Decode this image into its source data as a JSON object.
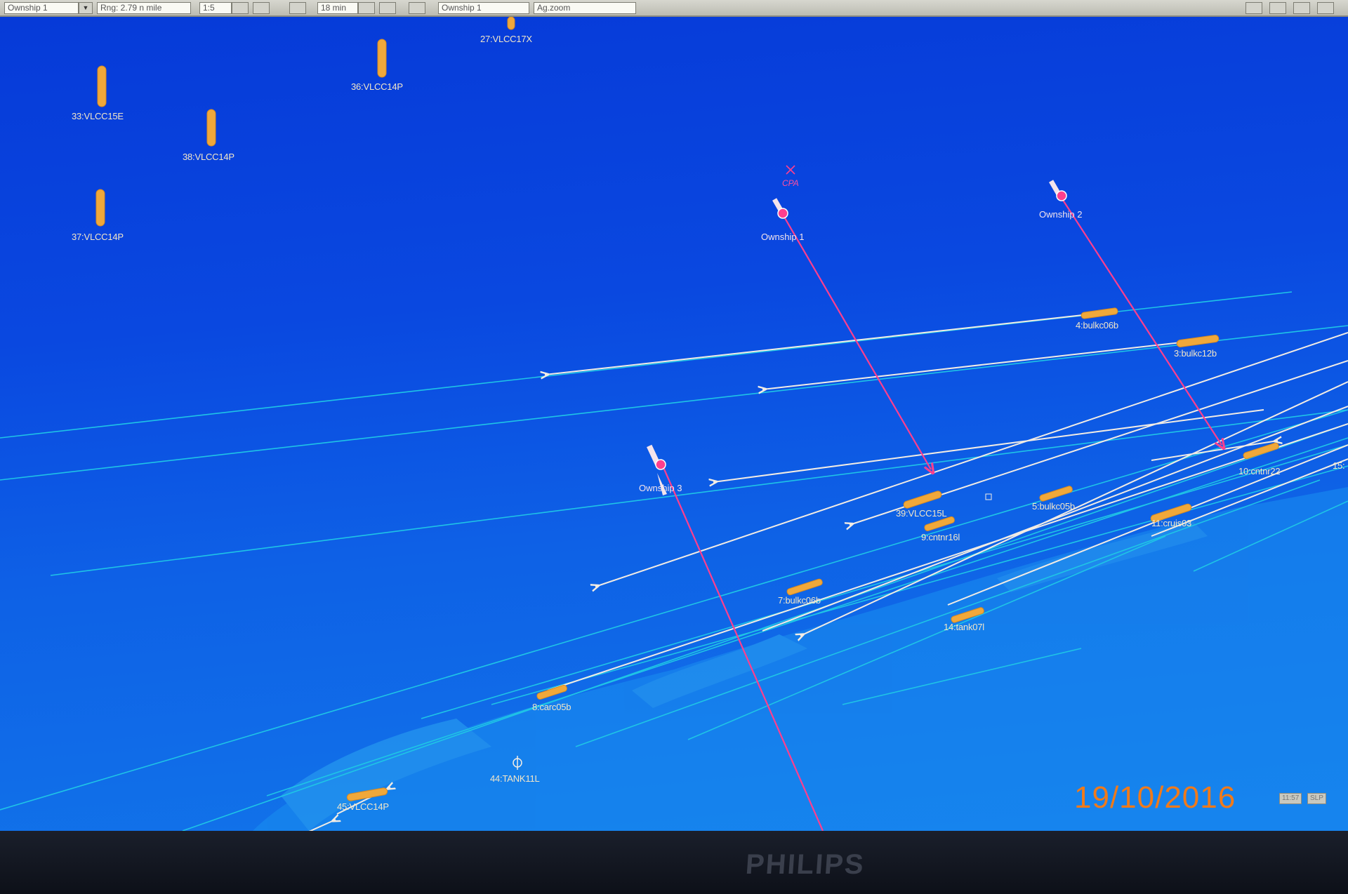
{
  "toolbar": {
    "ownship_select": "Ownship 1",
    "ring_field": "Rng: 2.79 n mile",
    "scale_field": "1:5",
    "time_field": "18 min",
    "ownship_select_2": "Ownship 1",
    "extra_field": "Ag.zoom"
  },
  "display": {
    "background_color": "#0a48e0",
    "track_color": "#f2ece4",
    "wake_color": "#1fc4e6",
    "ownship_vector_color": "#ff3f8e",
    "vessel_color": "#f0a83a"
  },
  "vessels": [
    {
      "label": "27:VLCC17X"
    },
    {
      "label": "36:VLCC14P"
    },
    {
      "label": "33:VLCC15E"
    },
    {
      "label": "38:VLCC14P"
    },
    {
      "label": "37:VLCC14P"
    },
    {
      "label": "4:bulkc06b"
    },
    {
      "label": "3:bulkc12b"
    },
    {
      "label": "10:cntnr22"
    },
    {
      "label": "15:"
    },
    {
      "label": "39:VLCC15L"
    },
    {
      "label": "5:bulkc05b"
    },
    {
      "label": "9:cntnr16l"
    },
    {
      "label": "11:cruis03"
    },
    {
      "label": "7:bulkc06b"
    },
    {
      "label": "14:tank07l"
    },
    {
      "label": "8:carc05b"
    },
    {
      "label": "44:TANK11L"
    },
    {
      "label": "45:VLCC14P"
    }
  ],
  "ownships": [
    {
      "label": "Ownship 1"
    },
    {
      "label": "Ownship 2"
    },
    {
      "label": "Ownship 3"
    }
  ],
  "cpa_label": "CPA",
  "status": {
    "time": "11:57",
    "mode": "SLP"
  },
  "monitor_brand": "PHILIPS",
  "photo_timestamp": "19/10/2016"
}
